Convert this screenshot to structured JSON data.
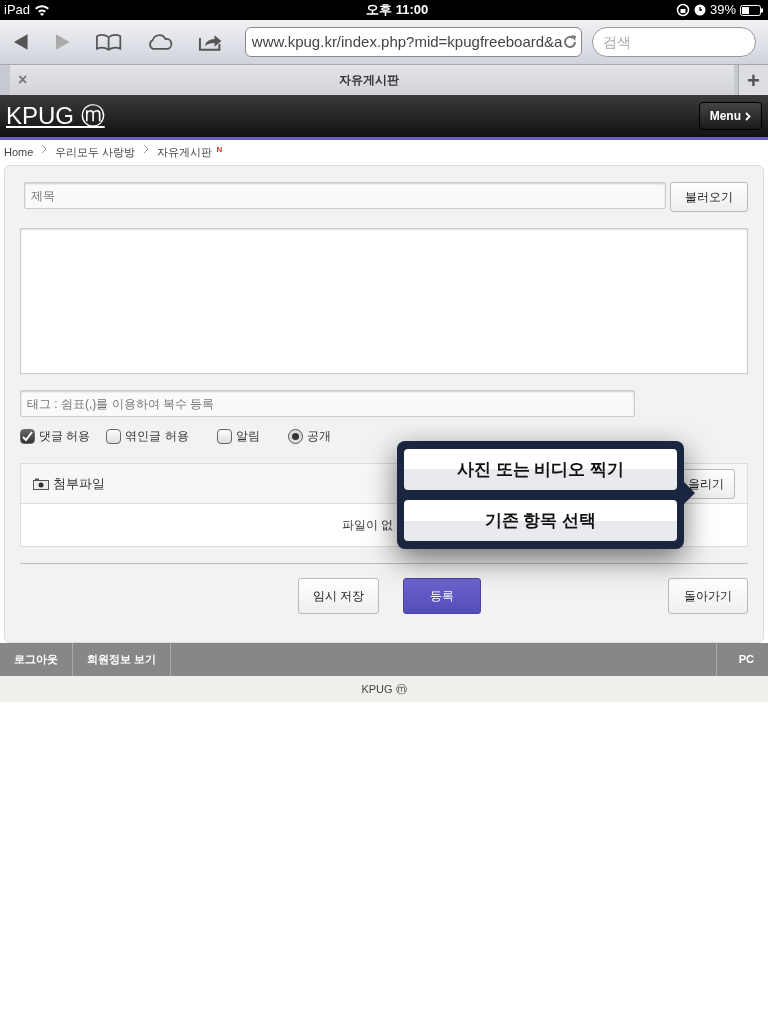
{
  "status_bar": {
    "device": "iPad",
    "time": "오후 11:00",
    "battery": "39%"
  },
  "browser": {
    "url": "www.kpug.kr/index.php?mid=kpugfreeboard&a",
    "search_placeholder": "검색",
    "tab_close": "×",
    "tab_title": "자유게시판",
    "new_tab": "+"
  },
  "site": {
    "logo": "KPUG ⓜ",
    "menu_button": "Menu"
  },
  "breadcrumb": {
    "items": [
      "Home",
      "우리모두 사랑방",
      "자유게시판"
    ],
    "badge": "N"
  },
  "form": {
    "title_placeholder": "제목",
    "load_button": "불러오기",
    "tag_placeholder": "태그 : 쉼표(,)를 이용하여 복수 등록",
    "options": [
      {
        "kind": "checkbox",
        "label": "댓글 허용",
        "checked": true
      },
      {
        "kind": "checkbox",
        "label": "엮인글 허용",
        "checked": false
      },
      {
        "kind": "checkbox",
        "label": "알림",
        "checked": false
      },
      {
        "kind": "radio",
        "label": "공개",
        "checked": true
      }
    ],
    "attachment": {
      "title": "첨부파일",
      "upload_button": "올리기",
      "empty_text": "파일이 없"
    },
    "buttons": [
      {
        "label": "임시 저장",
        "primary": false
      },
      {
        "label": "등록",
        "primary": true
      }
    ],
    "back_button": "돌아가기"
  },
  "popover": {
    "items": [
      "사진 또는 비디오 찍기",
      "기존 항목 선택"
    ]
  },
  "footer": {
    "links": [
      "로그아웃",
      "회원정보 보기"
    ],
    "pc_link": "PC",
    "copyright": "KPUG ⓜ"
  }
}
